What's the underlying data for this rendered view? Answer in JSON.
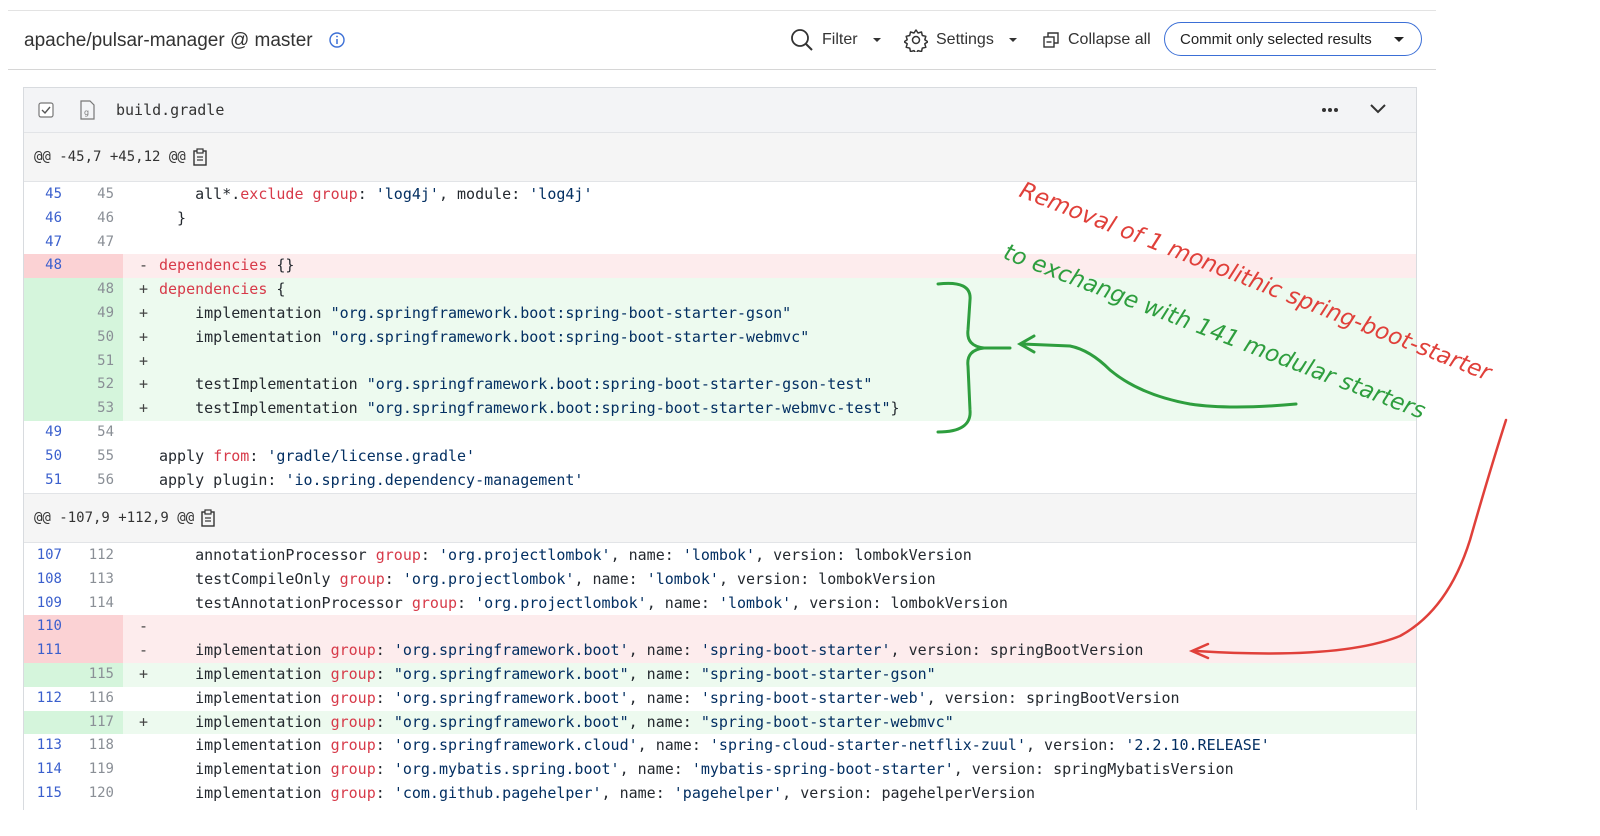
{
  "toolbar": {
    "repo": "apache/pulsar-manager @ master",
    "filter_label": "Filter",
    "settings_label": "Settings",
    "collapse_label": "Collapse all",
    "commit_label": "Commit only selected results"
  },
  "file": {
    "name": "build.gradle"
  },
  "hunks": [
    {
      "header": "@@ -45,7 +45,12 @@",
      "rows": [
        {
          "type": "ctx",
          "old": "45",
          "new": "45",
          "sign": "",
          "tokens": [
            [
              "p",
              "    all*."
            ],
            [
              "k",
              "exclude"
            ],
            [
              "p",
              " "
            ],
            [
              "k",
              "group"
            ],
            [
              "p",
              ": "
            ],
            [
              "s",
              "'log4j'"
            ],
            [
              "p",
              ", module: "
            ],
            [
              "s",
              "'log4j'"
            ]
          ]
        },
        {
          "type": "ctx",
          "old": "46",
          "new": "46",
          "sign": "",
          "tokens": [
            [
              "p",
              "  }"
            ]
          ]
        },
        {
          "type": "ctx",
          "old": "47",
          "new": "47",
          "sign": "",
          "tokens": [
            [
              "p",
              ""
            ]
          ]
        },
        {
          "type": "del",
          "old": "48",
          "new": "",
          "sign": "-",
          "tokens": [
            [
              "k",
              "dependencies"
            ],
            [
              "p",
              " {}"
            ]
          ]
        },
        {
          "type": "add",
          "old": "",
          "new": "48",
          "sign": "+",
          "tokens": [
            [
              "k",
              "dependencies"
            ],
            [
              "p",
              " {"
            ]
          ]
        },
        {
          "type": "add",
          "old": "",
          "new": "49",
          "sign": "+",
          "tokens": [
            [
              "p",
              "    implementation "
            ],
            [
              "s",
              "\"org.springframework.boot:spring-boot-starter-gson\""
            ]
          ]
        },
        {
          "type": "add",
          "old": "",
          "new": "50",
          "sign": "+",
          "tokens": [
            [
              "p",
              "    implementation "
            ],
            [
              "s",
              "\"org.springframework.boot:spring-boot-starter-webmvc\""
            ]
          ]
        },
        {
          "type": "add",
          "old": "",
          "new": "51",
          "sign": "+",
          "tokens": [
            [
              "p",
              ""
            ]
          ]
        },
        {
          "type": "add",
          "old": "",
          "new": "52",
          "sign": "+",
          "tokens": [
            [
              "p",
              "    testImplementation "
            ],
            [
              "s",
              "\"org.springframework.boot:spring-boot-starter-gson-test\""
            ]
          ]
        },
        {
          "type": "add",
          "old": "",
          "new": "53",
          "sign": "+",
          "tokens": [
            [
              "p",
              "    testImplementation "
            ],
            [
              "s",
              "\"org.springframework.boot:spring-boot-starter-webmvc-test\""
            ],
            [
              "p",
              "}"
            ]
          ]
        },
        {
          "type": "ctx",
          "old": "49",
          "new": "54",
          "sign": "",
          "tokens": [
            [
              "p",
              ""
            ]
          ]
        },
        {
          "type": "ctx",
          "old": "50",
          "new": "55",
          "sign": "",
          "tokens": [
            [
              "p",
              "apply "
            ],
            [
              "k",
              "from"
            ],
            [
              "p",
              ": "
            ],
            [
              "s",
              "'gradle/license.gradle'"
            ]
          ]
        },
        {
          "type": "ctx",
          "old": "51",
          "new": "56",
          "sign": "",
          "tokens": [
            [
              "p",
              "apply plugin: "
            ],
            [
              "s",
              "'io.spring.dependency-management'"
            ]
          ]
        }
      ]
    },
    {
      "header": "@@ -107,9 +112,9 @@",
      "rows": [
        {
          "type": "ctx",
          "old": "107",
          "new": "112",
          "sign": "",
          "tokens": [
            [
              "p",
              "    annotationProcessor "
            ],
            [
              "k",
              "group"
            ],
            [
              "p",
              ": "
            ],
            [
              "s",
              "'org.projectlombok'"
            ],
            [
              "p",
              ", name: "
            ],
            [
              "s",
              "'lombok'"
            ],
            [
              "p",
              ", version: lombokVersion"
            ]
          ]
        },
        {
          "type": "ctx",
          "old": "108",
          "new": "113",
          "sign": "",
          "tokens": [
            [
              "p",
              "    testCompileOnly "
            ],
            [
              "k",
              "group"
            ],
            [
              "p",
              ": "
            ],
            [
              "s",
              "'org.projectlombok'"
            ],
            [
              "p",
              ", name: "
            ],
            [
              "s",
              "'lombok'"
            ],
            [
              "p",
              ", version: lombokVersion"
            ]
          ]
        },
        {
          "type": "ctx",
          "old": "109",
          "new": "114",
          "sign": "",
          "tokens": [
            [
              "p",
              "    testAnnotationProcessor "
            ],
            [
              "k",
              "group"
            ],
            [
              "p",
              ": "
            ],
            [
              "s",
              "'org.projectlombok'"
            ],
            [
              "p",
              ", name: "
            ],
            [
              "s",
              "'lombok'"
            ],
            [
              "p",
              ", version: lombokVersion"
            ]
          ]
        },
        {
          "type": "del",
          "old": "110",
          "new": "",
          "sign": "-",
          "tokens": [
            [
              "p",
              ""
            ]
          ]
        },
        {
          "type": "del",
          "old": "111",
          "new": "",
          "sign": "-",
          "tokens": [
            [
              "p",
              "    implementation "
            ],
            [
              "k",
              "group"
            ],
            [
              "p",
              ": "
            ],
            [
              "s",
              "'org.springframework.boot'"
            ],
            [
              "p",
              ", name: "
            ],
            [
              "s",
              "'spring-boot-starter'"
            ],
            [
              "p",
              ", version: springBootVersion"
            ]
          ]
        },
        {
          "type": "add",
          "old": "",
          "new": "115",
          "sign": "+",
          "tokens": [
            [
              "p",
              "    implementation "
            ],
            [
              "k",
              "group"
            ],
            [
              "p",
              ": "
            ],
            [
              "s",
              "\"org.springframework.boot\""
            ],
            [
              "p",
              ", name: "
            ],
            [
              "s",
              "\"spring-boot-starter-gson\""
            ]
          ]
        },
        {
          "type": "ctx",
          "old": "112",
          "new": "116",
          "sign": "",
          "tokens": [
            [
              "p",
              "    implementation "
            ],
            [
              "k",
              "group"
            ],
            [
              "p",
              ": "
            ],
            [
              "s",
              "'org.springframework.boot'"
            ],
            [
              "p",
              ", name: "
            ],
            [
              "s",
              "'spring-boot-starter-web'"
            ],
            [
              "p",
              ", version: springBootVersion"
            ]
          ]
        },
        {
          "type": "add",
          "old": "",
          "new": "117",
          "sign": "+",
          "tokens": [
            [
              "p",
              "    implementation "
            ],
            [
              "k",
              "group"
            ],
            [
              "p",
              ": "
            ],
            [
              "s",
              "\"org.springframework.boot\""
            ],
            [
              "p",
              ", name: "
            ],
            [
              "s",
              "\"spring-boot-starter-webmvc\""
            ]
          ]
        },
        {
          "type": "ctx",
          "old": "113",
          "new": "118",
          "sign": "",
          "tokens": [
            [
              "p",
              "    implementation "
            ],
            [
              "k",
              "group"
            ],
            [
              "p",
              ": "
            ],
            [
              "s",
              "'org.springframework.cloud'"
            ],
            [
              "p",
              ", name: "
            ],
            [
              "s",
              "'spring-cloud-starter-netflix-zuul'"
            ],
            [
              "p",
              ", version: "
            ],
            [
              "s",
              "'2.2.10.RELEASE'"
            ]
          ]
        },
        {
          "type": "ctx",
          "old": "114",
          "new": "119",
          "sign": "",
          "tokens": [
            [
              "p",
              "    implementation "
            ],
            [
              "k",
              "group"
            ],
            [
              "p",
              ": "
            ],
            [
              "s",
              "'org.mybatis.spring.boot'"
            ],
            [
              "p",
              ", name: "
            ],
            [
              "s",
              "'mybatis-spring-boot-starter'"
            ],
            [
              "p",
              ", version: springMybatisVersion"
            ]
          ]
        },
        {
          "type": "ctx",
          "old": "115",
          "new": "120",
          "sign": "",
          "tokens": [
            [
              "p",
              "    implementation "
            ],
            [
              "k",
              "group"
            ],
            [
              "p",
              ": "
            ],
            [
              "s",
              "'com.github.pagehelper'"
            ],
            [
              "p",
              ", name: "
            ],
            [
              "s",
              "'pagehelper'"
            ],
            [
              "p",
              ", version: pagehelperVersion"
            ]
          ]
        }
      ]
    }
  ],
  "annotations": {
    "red_text": "Removal of 1 monolithic spring-boot-starter",
    "green_text_line1": "to exchange with 141 modular starters",
    "red_color": "#e0403a",
    "green_color": "#2e9e3e"
  },
  "colors": {
    "accent": "#3b6fd6",
    "added_bg": "#edfaef",
    "removed_bg": "#fdeced",
    "keyword": "#d73a49",
    "string": "#032f62"
  }
}
